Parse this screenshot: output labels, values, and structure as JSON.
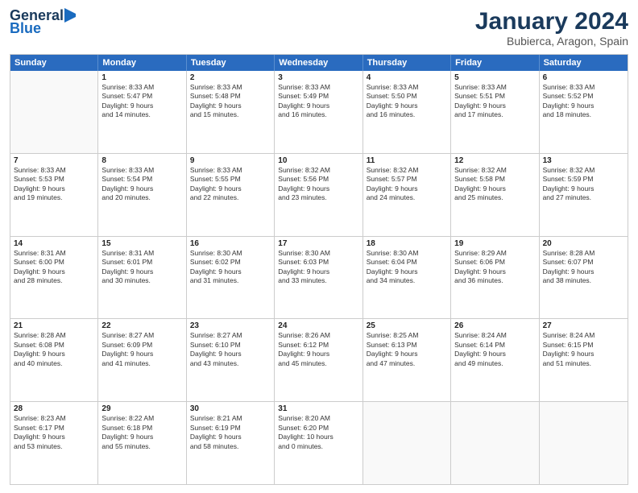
{
  "logo": {
    "general": "General",
    "blue": "Blue"
  },
  "title": "January 2024",
  "subtitle": "Bubierca, Aragon, Spain",
  "days": [
    "Sunday",
    "Monday",
    "Tuesday",
    "Wednesday",
    "Thursday",
    "Friday",
    "Saturday"
  ],
  "rows": [
    [
      {
        "day": "",
        "lines": []
      },
      {
        "day": "1",
        "lines": [
          "Sunrise: 8:33 AM",
          "Sunset: 5:47 PM",
          "Daylight: 9 hours",
          "and 14 minutes."
        ]
      },
      {
        "day": "2",
        "lines": [
          "Sunrise: 8:33 AM",
          "Sunset: 5:48 PM",
          "Daylight: 9 hours",
          "and 15 minutes."
        ]
      },
      {
        "day": "3",
        "lines": [
          "Sunrise: 8:33 AM",
          "Sunset: 5:49 PM",
          "Daylight: 9 hours",
          "and 16 minutes."
        ]
      },
      {
        "day": "4",
        "lines": [
          "Sunrise: 8:33 AM",
          "Sunset: 5:50 PM",
          "Daylight: 9 hours",
          "and 16 minutes."
        ]
      },
      {
        "day": "5",
        "lines": [
          "Sunrise: 8:33 AM",
          "Sunset: 5:51 PM",
          "Daylight: 9 hours",
          "and 17 minutes."
        ]
      },
      {
        "day": "6",
        "lines": [
          "Sunrise: 8:33 AM",
          "Sunset: 5:52 PM",
          "Daylight: 9 hours",
          "and 18 minutes."
        ]
      }
    ],
    [
      {
        "day": "7",
        "lines": [
          "Sunrise: 8:33 AM",
          "Sunset: 5:53 PM",
          "Daylight: 9 hours",
          "and 19 minutes."
        ]
      },
      {
        "day": "8",
        "lines": [
          "Sunrise: 8:33 AM",
          "Sunset: 5:54 PM",
          "Daylight: 9 hours",
          "and 20 minutes."
        ]
      },
      {
        "day": "9",
        "lines": [
          "Sunrise: 8:33 AM",
          "Sunset: 5:55 PM",
          "Daylight: 9 hours",
          "and 22 minutes."
        ]
      },
      {
        "day": "10",
        "lines": [
          "Sunrise: 8:32 AM",
          "Sunset: 5:56 PM",
          "Daylight: 9 hours",
          "and 23 minutes."
        ]
      },
      {
        "day": "11",
        "lines": [
          "Sunrise: 8:32 AM",
          "Sunset: 5:57 PM",
          "Daylight: 9 hours",
          "and 24 minutes."
        ]
      },
      {
        "day": "12",
        "lines": [
          "Sunrise: 8:32 AM",
          "Sunset: 5:58 PM",
          "Daylight: 9 hours",
          "and 25 minutes."
        ]
      },
      {
        "day": "13",
        "lines": [
          "Sunrise: 8:32 AM",
          "Sunset: 5:59 PM",
          "Daylight: 9 hours",
          "and 27 minutes."
        ]
      }
    ],
    [
      {
        "day": "14",
        "lines": [
          "Sunrise: 8:31 AM",
          "Sunset: 6:00 PM",
          "Daylight: 9 hours",
          "and 28 minutes."
        ]
      },
      {
        "day": "15",
        "lines": [
          "Sunrise: 8:31 AM",
          "Sunset: 6:01 PM",
          "Daylight: 9 hours",
          "and 30 minutes."
        ]
      },
      {
        "day": "16",
        "lines": [
          "Sunrise: 8:30 AM",
          "Sunset: 6:02 PM",
          "Daylight: 9 hours",
          "and 31 minutes."
        ]
      },
      {
        "day": "17",
        "lines": [
          "Sunrise: 8:30 AM",
          "Sunset: 6:03 PM",
          "Daylight: 9 hours",
          "and 33 minutes."
        ]
      },
      {
        "day": "18",
        "lines": [
          "Sunrise: 8:30 AM",
          "Sunset: 6:04 PM",
          "Daylight: 9 hours",
          "and 34 minutes."
        ]
      },
      {
        "day": "19",
        "lines": [
          "Sunrise: 8:29 AM",
          "Sunset: 6:06 PM",
          "Daylight: 9 hours",
          "and 36 minutes."
        ]
      },
      {
        "day": "20",
        "lines": [
          "Sunrise: 8:28 AM",
          "Sunset: 6:07 PM",
          "Daylight: 9 hours",
          "and 38 minutes."
        ]
      }
    ],
    [
      {
        "day": "21",
        "lines": [
          "Sunrise: 8:28 AM",
          "Sunset: 6:08 PM",
          "Daylight: 9 hours",
          "and 40 minutes."
        ]
      },
      {
        "day": "22",
        "lines": [
          "Sunrise: 8:27 AM",
          "Sunset: 6:09 PM",
          "Daylight: 9 hours",
          "and 41 minutes."
        ]
      },
      {
        "day": "23",
        "lines": [
          "Sunrise: 8:27 AM",
          "Sunset: 6:10 PM",
          "Daylight: 9 hours",
          "and 43 minutes."
        ]
      },
      {
        "day": "24",
        "lines": [
          "Sunrise: 8:26 AM",
          "Sunset: 6:12 PM",
          "Daylight: 9 hours",
          "and 45 minutes."
        ]
      },
      {
        "day": "25",
        "lines": [
          "Sunrise: 8:25 AM",
          "Sunset: 6:13 PM",
          "Daylight: 9 hours",
          "and 47 minutes."
        ]
      },
      {
        "day": "26",
        "lines": [
          "Sunrise: 8:24 AM",
          "Sunset: 6:14 PM",
          "Daylight: 9 hours",
          "and 49 minutes."
        ]
      },
      {
        "day": "27",
        "lines": [
          "Sunrise: 8:24 AM",
          "Sunset: 6:15 PM",
          "Daylight: 9 hours",
          "and 51 minutes."
        ]
      }
    ],
    [
      {
        "day": "28",
        "lines": [
          "Sunrise: 8:23 AM",
          "Sunset: 6:17 PM",
          "Daylight: 9 hours",
          "and 53 minutes."
        ]
      },
      {
        "day": "29",
        "lines": [
          "Sunrise: 8:22 AM",
          "Sunset: 6:18 PM",
          "Daylight: 9 hours",
          "and 55 minutes."
        ]
      },
      {
        "day": "30",
        "lines": [
          "Sunrise: 8:21 AM",
          "Sunset: 6:19 PM",
          "Daylight: 9 hours",
          "and 58 minutes."
        ]
      },
      {
        "day": "31",
        "lines": [
          "Sunrise: 8:20 AM",
          "Sunset: 6:20 PM",
          "Daylight: 10 hours",
          "and 0 minutes."
        ]
      },
      {
        "day": "",
        "lines": []
      },
      {
        "day": "",
        "lines": []
      },
      {
        "day": "",
        "lines": []
      }
    ]
  ]
}
